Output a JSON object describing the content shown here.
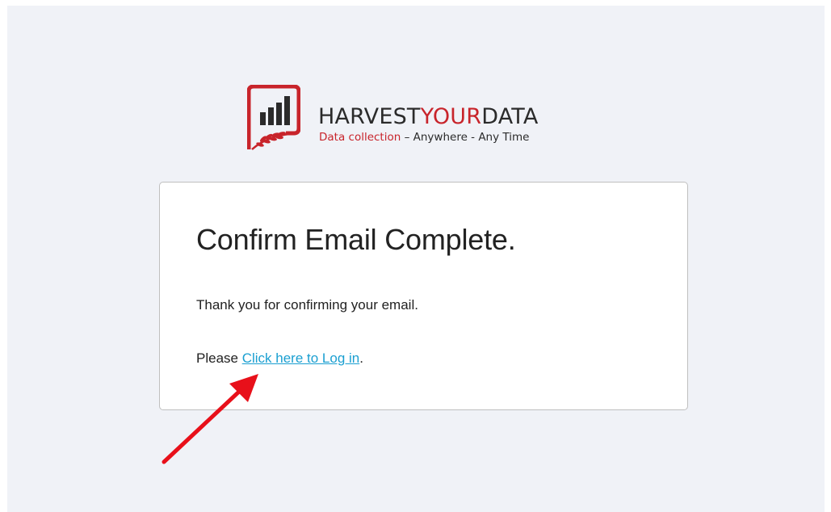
{
  "brand": {
    "name_part1": "HARVEST",
    "name_part2": "YOUR",
    "name_part3": "DATA",
    "tagline_part1": "Data collection",
    "tagline_part2": " – Anywhere - Any Time"
  },
  "card": {
    "title": "Confirm Email Complete.",
    "message": "Thank you for confirming your email.",
    "login_prefix": "Please ",
    "login_link": "Click here to Log in",
    "login_suffix": "."
  },
  "colors": {
    "brand_red": "#c8242b",
    "link": "#1a9fd1",
    "page_background": "#f0f2f7",
    "annotation_arrow": "#e8101a"
  }
}
